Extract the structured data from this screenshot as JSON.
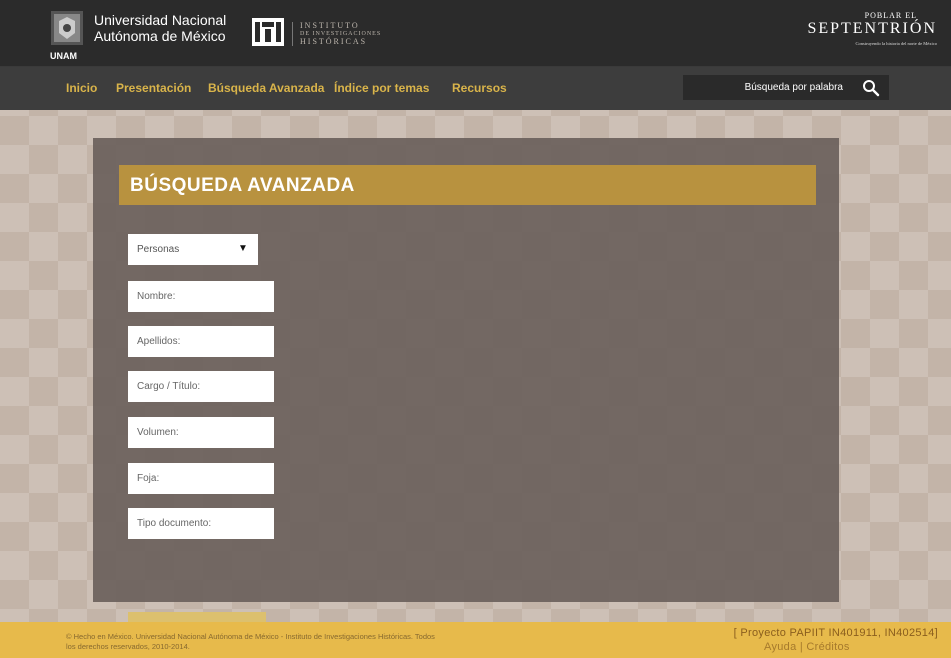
{
  "header": {
    "unam_word": "UNAM",
    "university_line1": "Universidad Nacional",
    "university_line2": "Autónoma de México",
    "institute_line1": "INSTITUTO",
    "institute_line2": "DE INVESTIGACIONES",
    "institute_line3": "HISTÓRICAS",
    "project_small": "POBLAR EL",
    "project_big": "SEPTENTRIÓN",
    "project_tagline": "Construyendo la historia del norte de México"
  },
  "nav": {
    "items": [
      "Inicio",
      "Presentación",
      "Búsqueda Avanzada",
      "Índice por temas",
      "Recursos"
    ],
    "search_placeholder": "Búsqueda por palabra",
    "search_icon": "magnifier-icon"
  },
  "panel": {
    "title": "BÚSQUEDA AVANZADA",
    "select_value": "Personas",
    "fields": [
      "Nombre:",
      "Apellidos:",
      "Cargo / Título:",
      "Volumen:",
      "Foja:",
      "Tipo documento:"
    ]
  },
  "footer": {
    "copyright_line1": "© Hecho en México. Universidad Nacional Autónoma de México - Instituto de Investigaciones Históricas. Todos",
    "copyright_line2": "los derechos reservados, 2010-2014.",
    "project": "[ Proyecto PAPIIT IN401911, IN402514]",
    "link_help": "Ayuda",
    "separator": " | ",
    "link_credits": "Créditos"
  },
  "colors": {
    "topbar": "#2b2b2b",
    "navbar": "#3d3d3d",
    "nav_link": "#d9b44a",
    "panel_header": "#b8923f",
    "footer": "#e7ba4b"
  }
}
